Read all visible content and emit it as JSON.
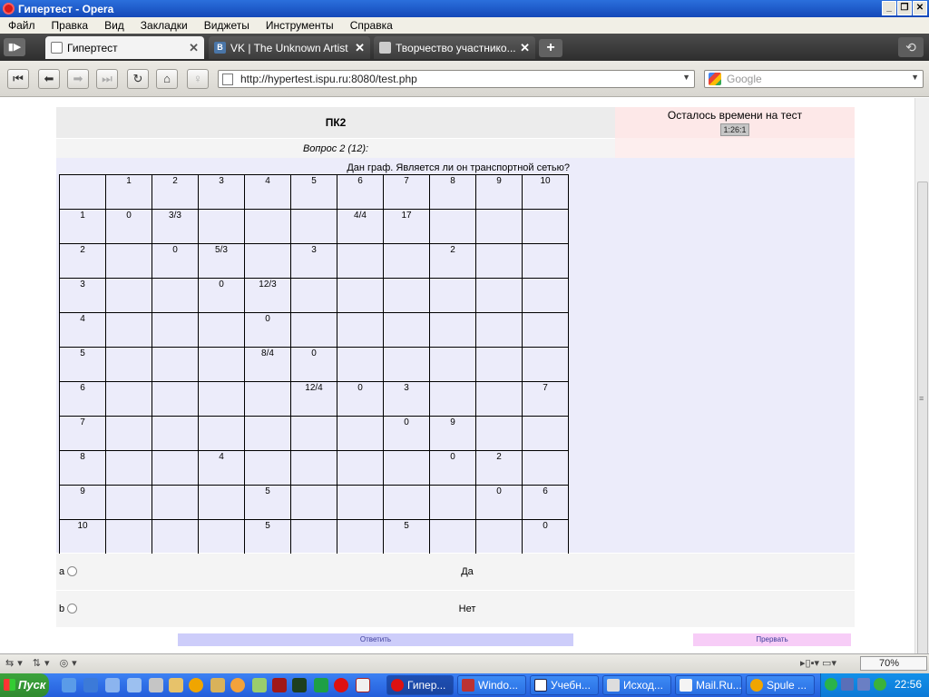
{
  "window": {
    "title": "Гипертест - Opera"
  },
  "menu": [
    "Файл",
    "Правка",
    "Вид",
    "Закладки",
    "Виджеты",
    "Инструменты",
    "Справка"
  ],
  "tabs": [
    {
      "label": "Гипертест",
      "active": true
    },
    {
      "label": "VK | The Unknown Artist",
      "active": false
    },
    {
      "label": "Творчество участнико...",
      "active": false
    }
  ],
  "nav": {
    "url": "http://hypertest.ispu.ru:8080/test.php",
    "search_placeholder": "Google"
  },
  "test": {
    "title": "ПК2",
    "time_label": "Осталось времени на тест",
    "timer": "1:26:1",
    "question_number": "Вопрос 2 (12):",
    "question_text": "Дан граф. Является ли он транспортной сетью?",
    "matrix": {
      "headers": [
        "",
        "1",
        "2",
        "3",
        "4",
        "5",
        "6",
        "7",
        "8",
        "9",
        "10"
      ],
      "rows": [
        [
          "1",
          "0",
          "3/3",
          "",
          "",
          "",
          "4/4",
          "17",
          "",
          "",
          ""
        ],
        [
          "2",
          "",
          "0",
          "5/3",
          "",
          "3",
          "",
          "",
          "2",
          "",
          ""
        ],
        [
          "3",
          "",
          "",
          "0",
          "12/3",
          "",
          "",
          "",
          "",
          "",
          ""
        ],
        [
          "4",
          "",
          "",
          "",
          "0",
          "",
          "",
          "",
          "",
          "",
          ""
        ],
        [
          "5",
          "",
          "",
          "",
          "8/4",
          "0",
          "",
          "",
          "",
          "",
          ""
        ],
        [
          "6",
          "",
          "",
          "",
          "",
          "12/4",
          "0",
          "3",
          "",
          "",
          "7"
        ],
        [
          "7",
          "",
          "",
          "",
          "",
          "",
          "",
          "0",
          "9",
          "",
          ""
        ],
        [
          "8",
          "",
          "",
          "4",
          "",
          "",
          "",
          "",
          "0",
          "2",
          ""
        ],
        [
          "9",
          "",
          "",
          "",
          "5",
          "",
          "",
          "",
          "",
          "0",
          "6"
        ],
        [
          "10",
          "",
          "",
          "",
          "5",
          "",
          "",
          "5",
          "",
          "",
          "0"
        ]
      ]
    },
    "answers": [
      {
        "letter": "a",
        "label": "Да"
      },
      {
        "letter": "b",
        "label": "Нет"
      }
    ],
    "submit_label": "Ответить",
    "abort_label": "Прервать"
  },
  "status": {
    "zoom": "70%"
  },
  "taskbar": {
    "start_label": "Пуск",
    "tasks": [
      "Гипер...",
      "Windo...",
      "Учебн...",
      "Исход...",
      "Mail.Ru...",
      "Spule ..."
    ],
    "clock": "22:56"
  }
}
